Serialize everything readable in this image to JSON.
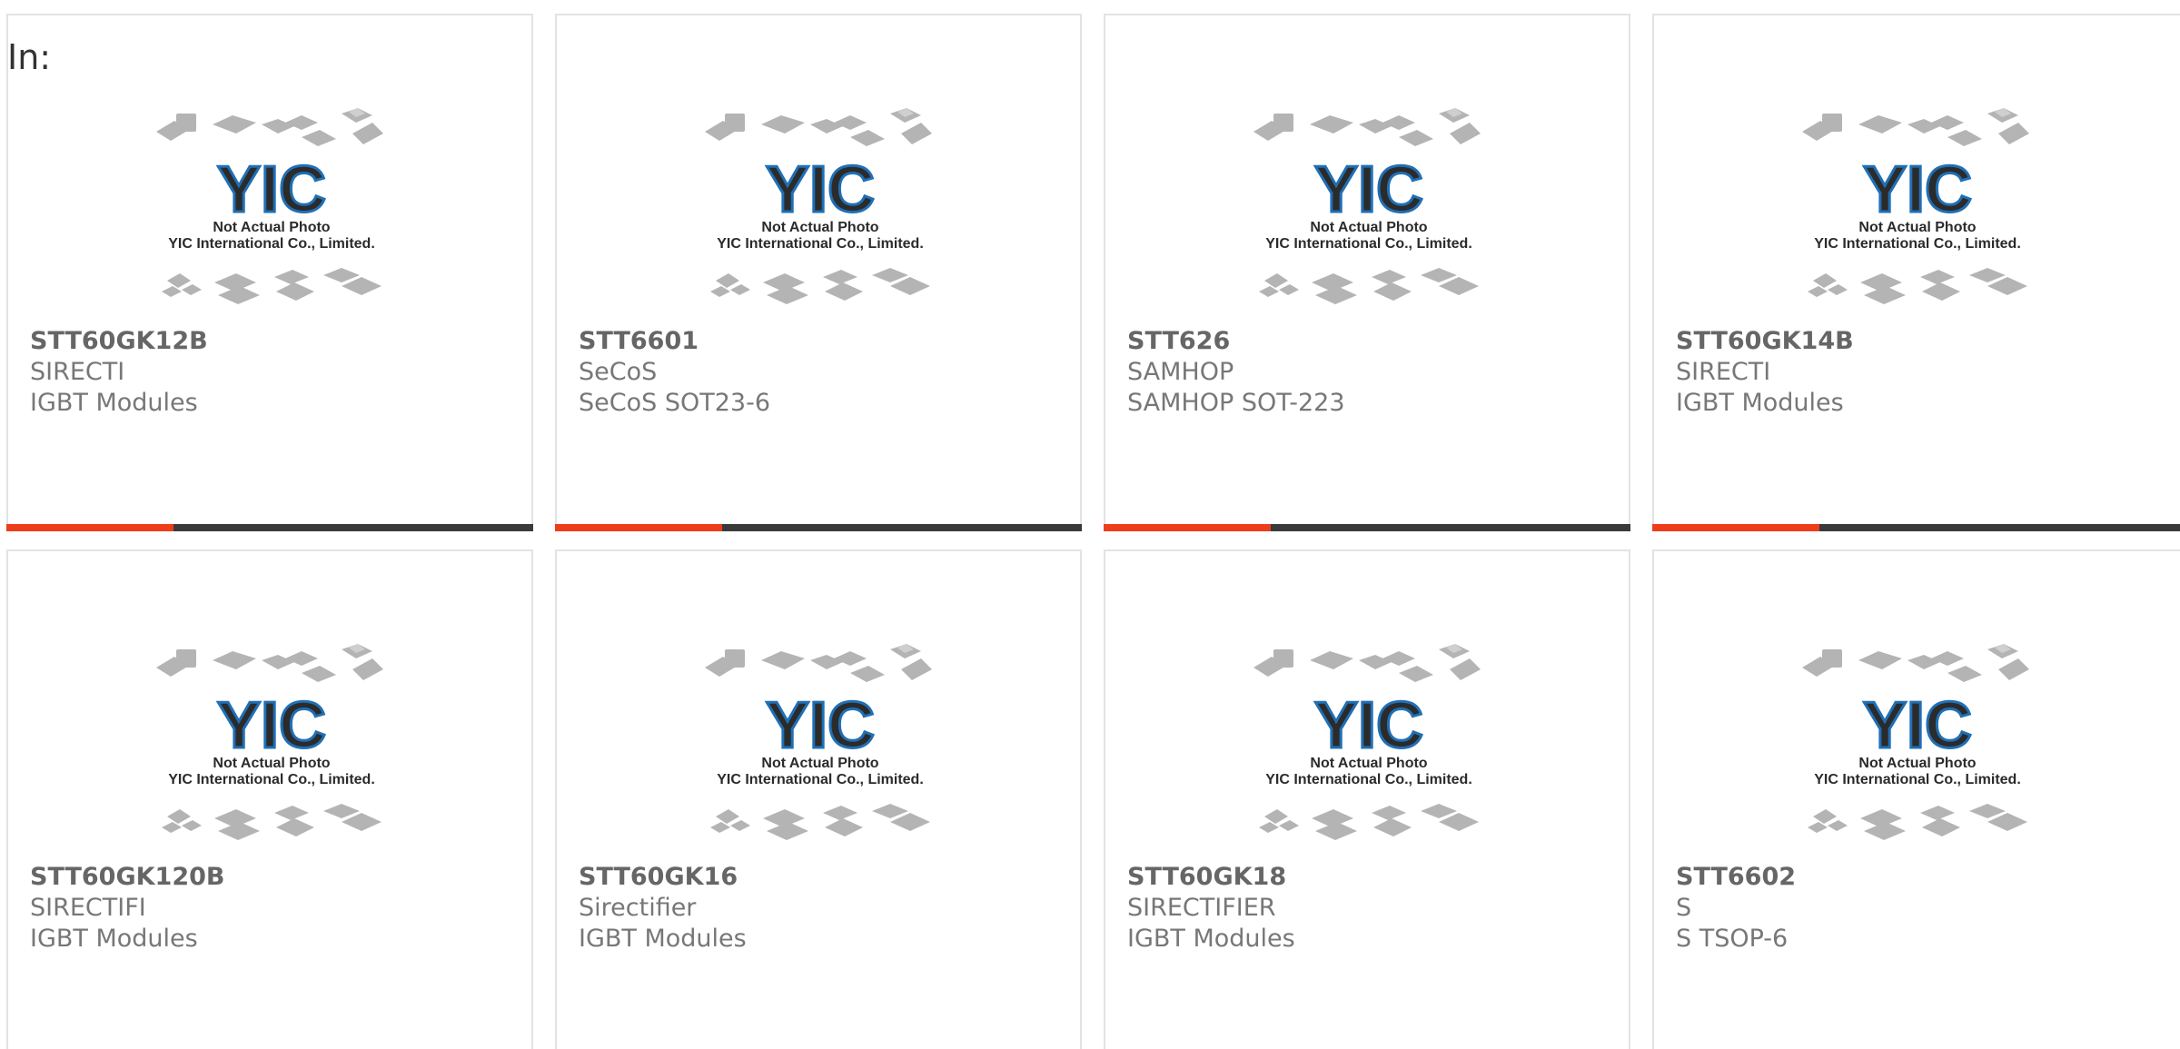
{
  "page": {
    "in_label": "In:"
  },
  "placeholder": {
    "logo_text": "YIC",
    "line1": "Not Actual Photo",
    "line2": "YIC International Co., Limited."
  },
  "products": [
    {
      "part": "STT60GK12B",
      "maker": "SIRECTI",
      "desc": "IGBT Modules"
    },
    {
      "part": "STT6601",
      "maker": "SeCoS",
      "desc": "SeCoS SOT23-6"
    },
    {
      "part": "STT626",
      "maker": "SAMHOP",
      "desc": "SAMHOP SOT-223"
    },
    {
      "part": "STT60GK14B",
      "maker": "SIRECTI",
      "desc": "IGBT Modules"
    },
    {
      "part": "STT60GK120B",
      "maker": "SIRECTIFI",
      "desc": "IGBT Modules"
    },
    {
      "part": "STT60GK16",
      "maker": "Sirectifier",
      "desc": "IGBT Modules"
    },
    {
      "part": "STT60GK18",
      "maker": "SIRECTIFIER",
      "desc": "IGBT Modules"
    },
    {
      "part": "STT6602",
      "maker": "S",
      "desc": "S TSOP-6"
    }
  ],
  "colors": {
    "accent": "#ee3d1a",
    "bar": "#3a3a3a",
    "logo_blue": "#1f6fb5"
  }
}
